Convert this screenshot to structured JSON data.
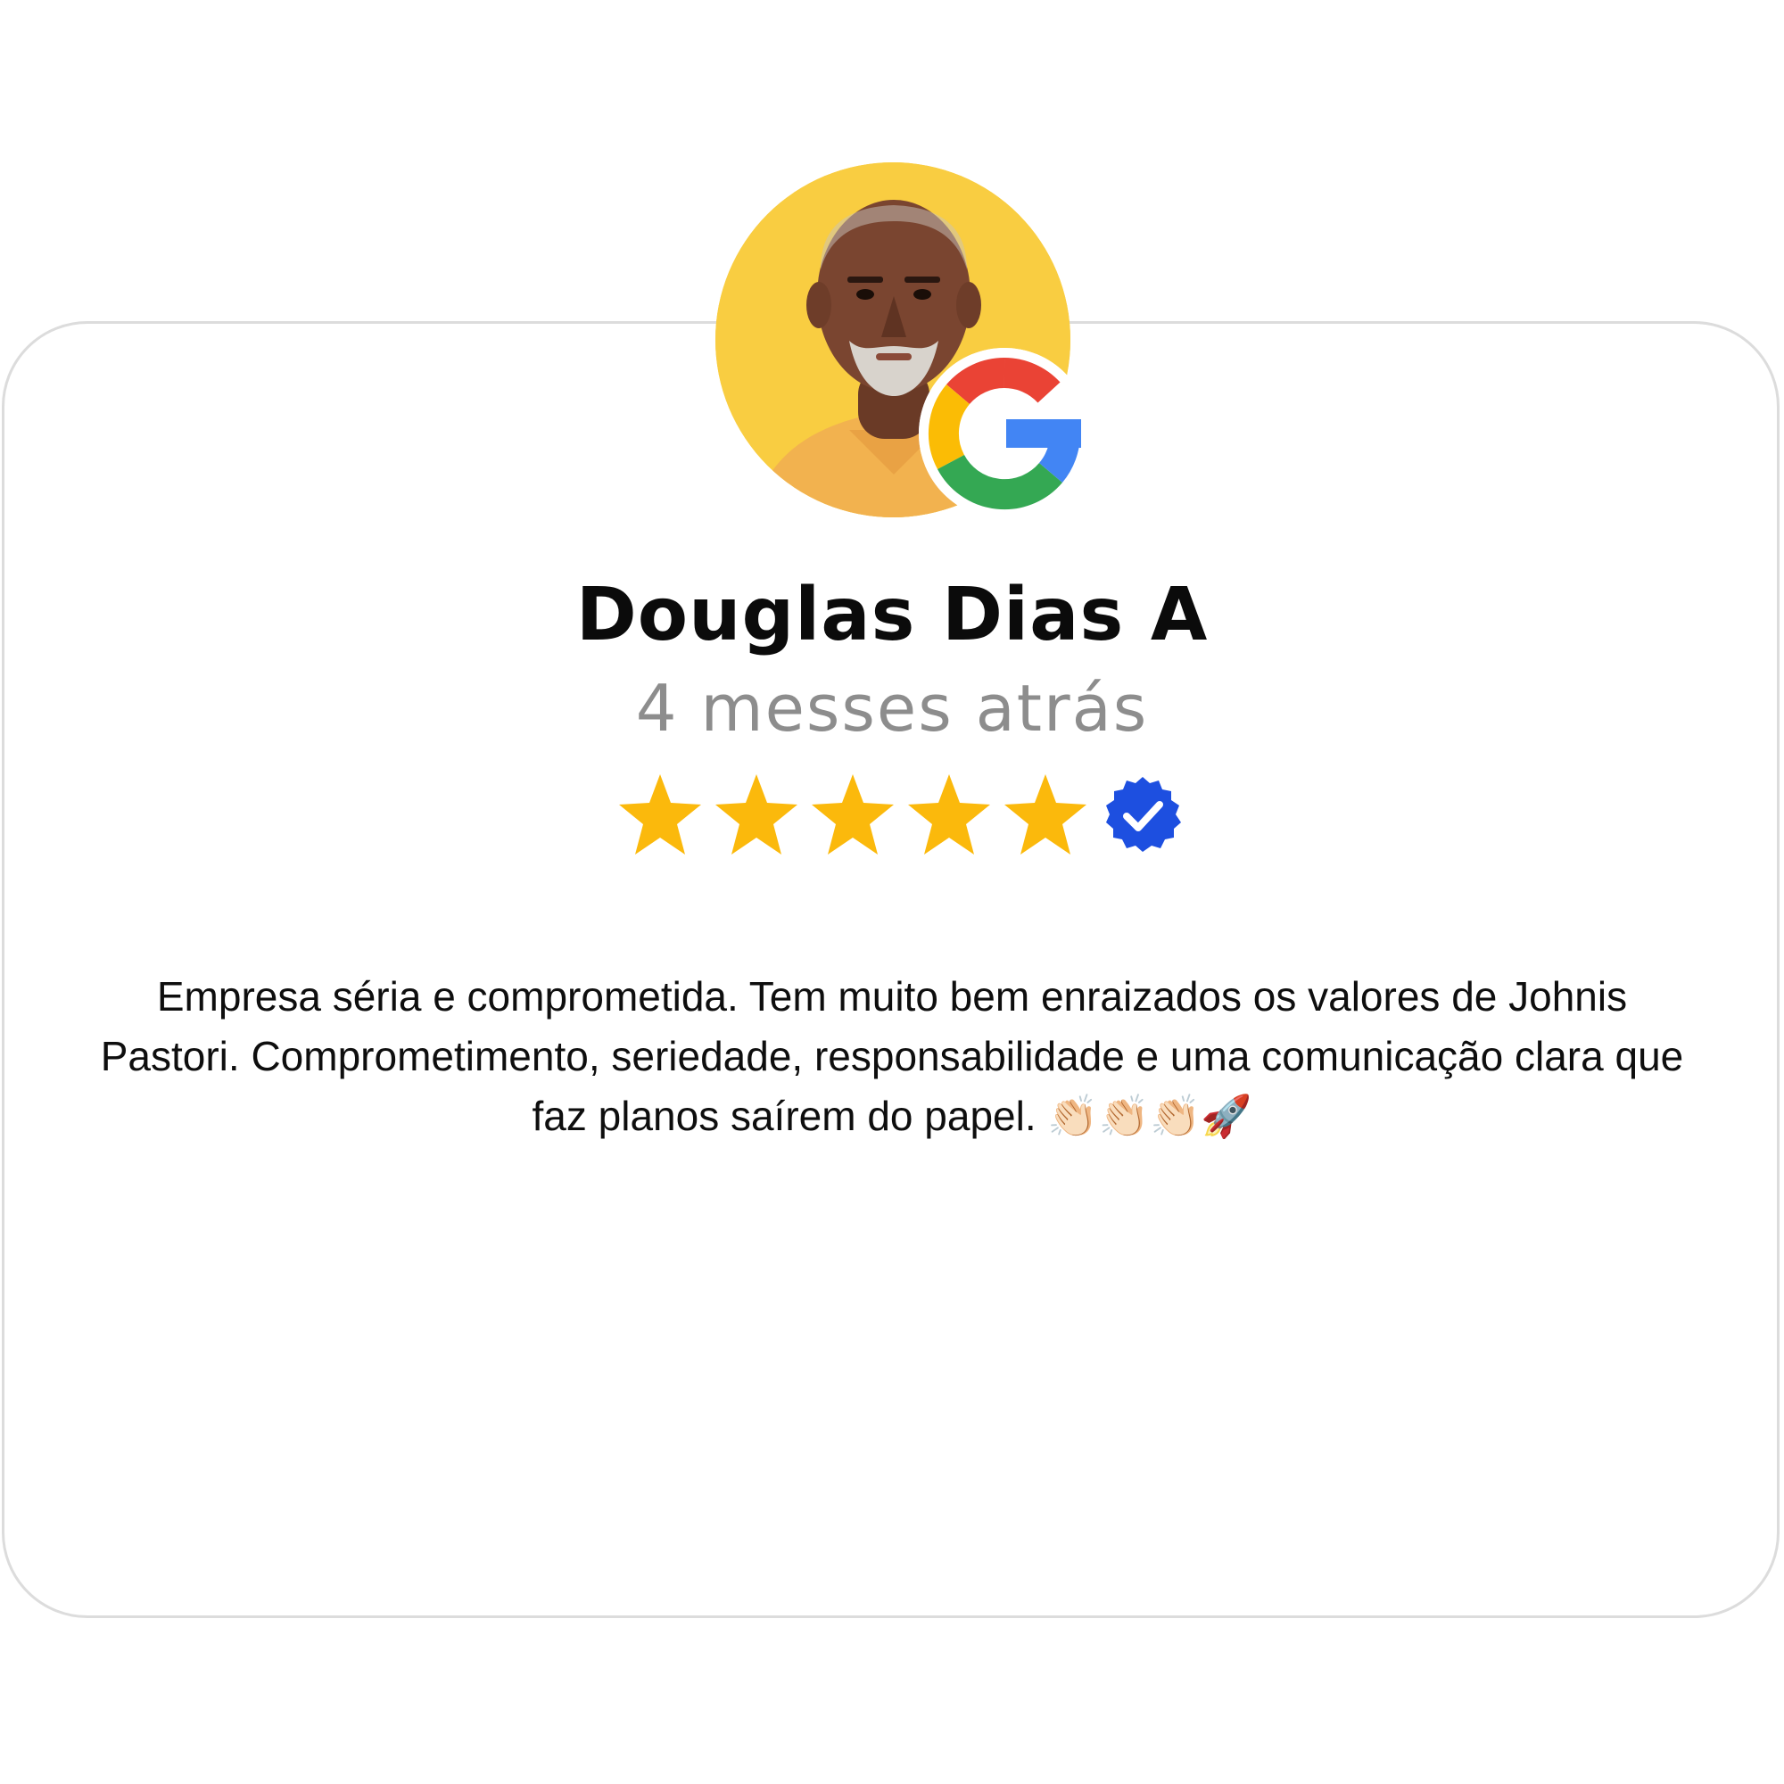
{
  "review": {
    "author_name": "Douglas Dias A",
    "time_ago": "4 messes atrás",
    "rating": 5,
    "rating_max": 5,
    "verified": true,
    "text": "Empresa séria e comprometida. Tem muito bem enraizados os valores de Johnis Pastori. Comprometimento, seriedade, responsabilidade e uma comunicação clara que faz planos saírem do papel. 👏🏻👏🏻👏🏻🚀",
    "avatar_icon": "person-photo",
    "badge_icon": "google-g-icon",
    "star_icon": "star-icon",
    "verified_icon": "verified-check-icon"
  },
  "colors": {
    "avatar_background": "#f9cd41",
    "star": "#fbb90c",
    "verified": "#1d4fe0",
    "name": "#0b0b0b",
    "time": "#8d8d8d",
    "card_border": "#dcdcdc"
  }
}
